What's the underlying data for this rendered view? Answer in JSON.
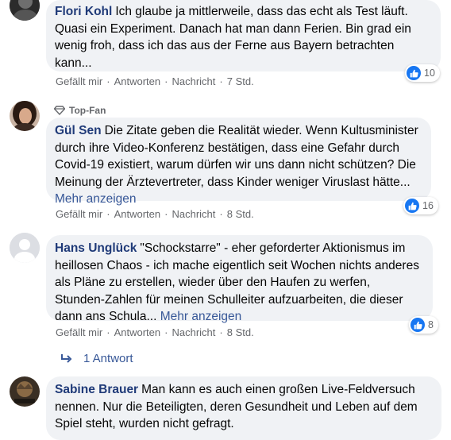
{
  "comments": [
    {
      "author": "Flori Kohl",
      "text": "Ich glaube ja mittlerweile, dass das echt als Test läuft. Quasi ein Experiment. Danach hat man dann Ferien. Bin grad ein wenig froh, dass ich das aus der Ferne aus Bayern betrachten kann...",
      "more": "",
      "like": "Gefällt mir",
      "reply": "Antworten",
      "message": "Nachricht",
      "time": "7 Std.",
      "likes": "10"
    },
    {
      "badge": "Top-Fan",
      "author": "Gül Sen",
      "text": "Die Zitate geben die Realität wieder. Wenn Kultusminister durch ihre Video-Konferenz bestätigen, dass eine Gefahr durch Covid-19 existiert, warum dürfen wir uns dann nicht schützen? Die Meinung der Ärztevertreter, dass Kinder weniger Viruslast hätte...",
      "more": "Mehr anzeigen",
      "like": "Gefällt mir",
      "reply": "Antworten",
      "message": "Nachricht",
      "time": "8 Std.",
      "likes": "16"
    },
    {
      "author": "Hans Unglück",
      "text": "\"Schockstarre\" - eher geforderter Aktionismus im heillosen Chaos - ich mache eigentlich seit Wochen nichts anderes als Pläne zu erstellen, wieder über den Haufen zu werfen, Stunden-Zahlen für meinen Schulleiter aufzuarbeiten, die dieser dann ans Schula...",
      "more": "Mehr anzeigen",
      "like": "Gefällt mir",
      "reply": "Antworten",
      "message": "Nachricht",
      "time": "8 Std.",
      "likes": "8",
      "replies": "1 Antwort"
    },
    {
      "author": "Sabine Brauer",
      "text": "Man kann es auch einen großen Live-Feldversuch nennen. Nur die Beteiligten, deren Gesundheit und Leben auf dem Spiel steht, wurden nicht gefragt."
    }
  ],
  "colors": {
    "author": "#1f3a78",
    "link": "#385898",
    "bubble": "#f0f2f5",
    "like": "#1877f2"
  },
  "icons": [
    "like-icon",
    "diamond-icon",
    "reply-arrow-icon"
  ]
}
